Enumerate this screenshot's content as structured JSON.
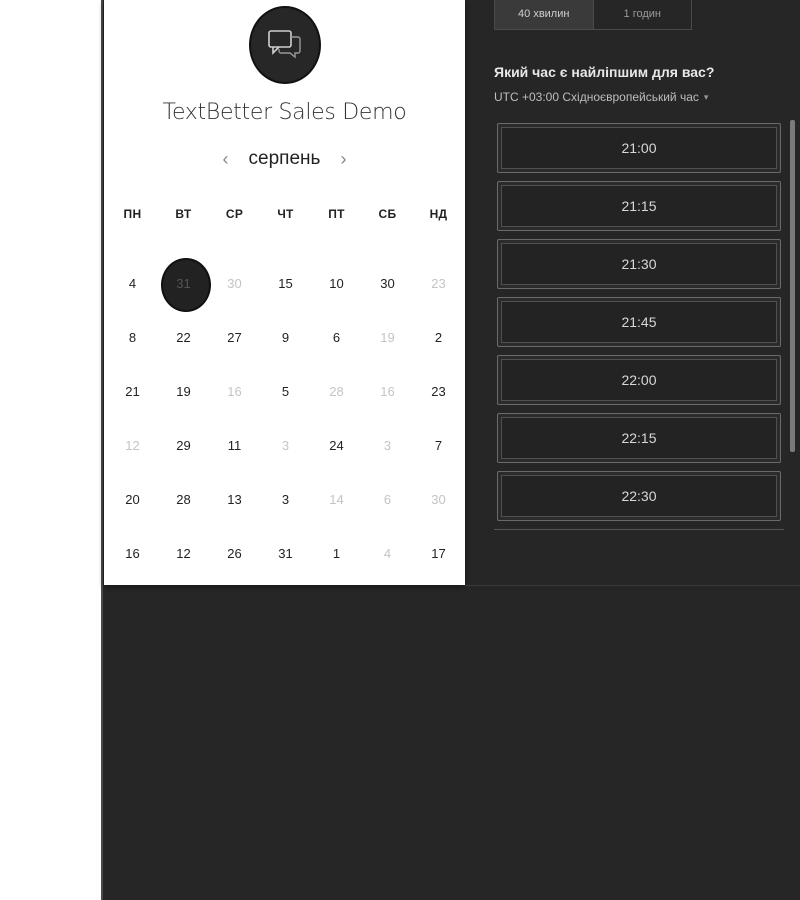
{
  "event": {
    "title": "TextBetter Sales Demo",
    "logo_icon": "chat-bubbles-icon"
  },
  "calendar": {
    "month": "серпень",
    "prev_icon": "chevron-left-icon",
    "next_icon": "chevron-right-icon",
    "prev_label": "‹",
    "next_label": "›",
    "weekdays": [
      "ПН",
      "ВТ",
      "СР",
      "ЧТ",
      "ПТ",
      "СБ",
      "НД"
    ],
    "weeks": [
      [
        {
          "d": "4",
          "m": false
        },
        {
          "d": "31",
          "m": false,
          "sel": true
        },
        {
          "d": "30",
          "m": true
        },
        {
          "d": "15",
          "m": false
        },
        {
          "d": "10",
          "m": false
        },
        {
          "d": "30",
          "m": false
        },
        {
          "d": "23",
          "m": true
        }
      ],
      [
        {
          "d": "8",
          "m": false
        },
        {
          "d": "22",
          "m": false
        },
        {
          "d": "27",
          "m": false
        },
        {
          "d": "9",
          "m": false
        },
        {
          "d": "6",
          "m": false
        },
        {
          "d": "19",
          "m": true
        },
        {
          "d": "2",
          "m": false
        }
      ],
      [
        {
          "d": "21",
          "m": false
        },
        {
          "d": "19",
          "m": false
        },
        {
          "d": "16",
          "m": true
        },
        {
          "d": "5",
          "m": false
        },
        {
          "d": "28",
          "m": true
        },
        {
          "d": "16",
          "m": true
        },
        {
          "d": "23",
          "m": false
        }
      ],
      [
        {
          "d": "12",
          "m": true
        },
        {
          "d": "29",
          "m": false
        },
        {
          "d": "11",
          "m": false
        },
        {
          "d": "3",
          "m": true
        },
        {
          "d": "24",
          "m": false
        },
        {
          "d": "3",
          "m": true
        },
        {
          "d": "7",
          "m": false
        }
      ],
      [
        {
          "d": "20",
          "m": false
        },
        {
          "d": "28",
          "m": false
        },
        {
          "d": "13",
          "m": false
        },
        {
          "d": "3",
          "m": false
        },
        {
          "d": "14",
          "m": true
        },
        {
          "d": "6",
          "m": true
        },
        {
          "d": "30",
          "m": true
        }
      ],
      [
        {
          "d": "16",
          "m": false
        },
        {
          "d": "12",
          "m": false
        },
        {
          "d": "26",
          "m": false
        },
        {
          "d": "31",
          "m": false
        },
        {
          "d": "1",
          "m": false
        },
        {
          "d": "4",
          "m": true
        },
        {
          "d": "17",
          "m": false
        }
      ]
    ]
  },
  "durations": [
    "40 хвилин",
    "1 годин"
  ],
  "time_picker": {
    "question": "Який час є найліпшим для вас?",
    "timezone": "UTC +03:00 Східноєвропейський час",
    "timezone_caret": "▾",
    "slots": [
      "21:00",
      "21:15",
      "21:30",
      "21:45",
      "22:00",
      "22:15",
      "22:30"
    ]
  },
  "colors": {
    "background_dark": "#262626",
    "card": "#ffffff",
    "selected_day": "#222222"
  }
}
